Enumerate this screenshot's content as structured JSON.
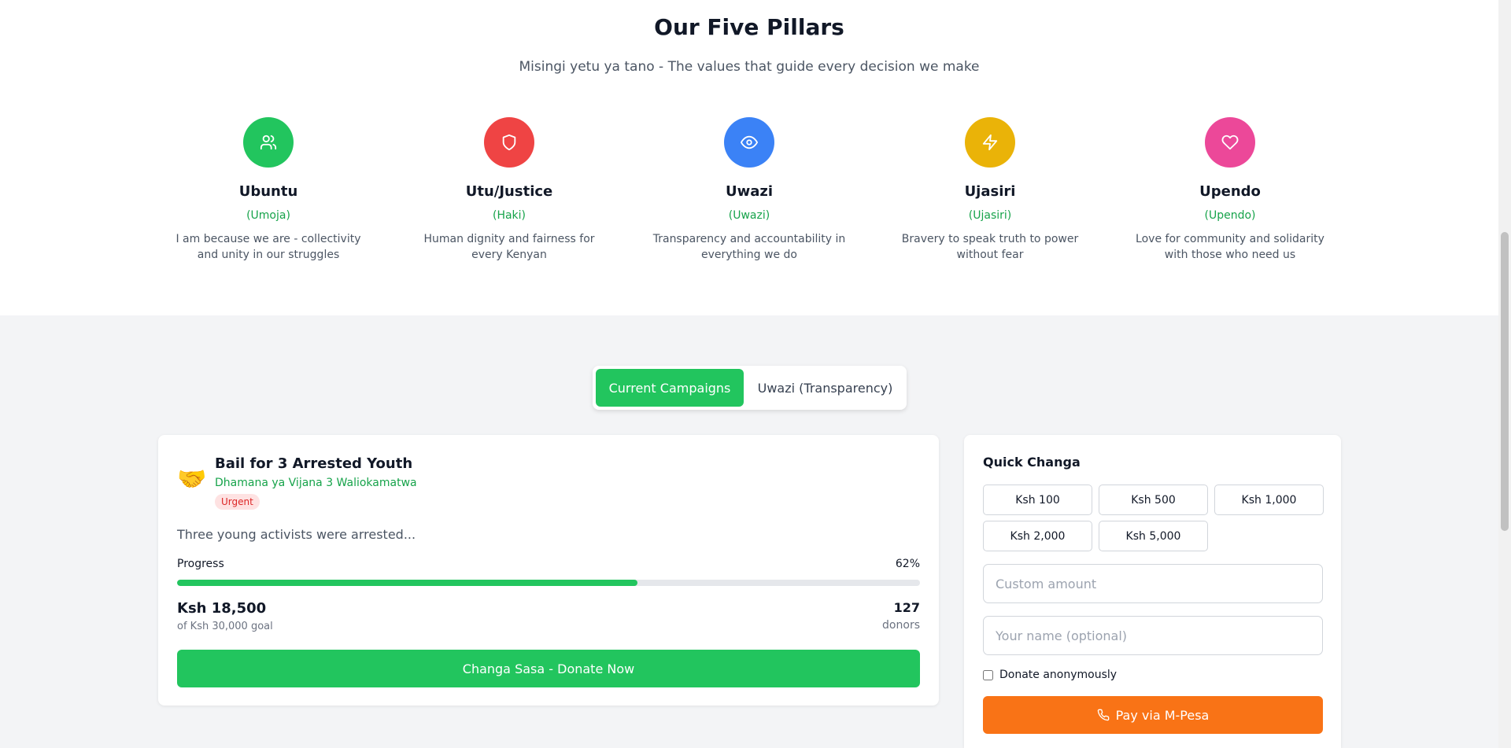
{
  "pillars": {
    "title": "Our Five Pillars",
    "subtitle": "Misingi yetu ya tano - The values that guide every decision we make",
    "items": [
      {
        "name": "Ubuntu",
        "sub": "(Umoja)",
        "desc": "I am because we are - collectivity and unity in our struggles",
        "icon": "users-icon",
        "color": "#22c55e"
      },
      {
        "name": "Utu/Justice",
        "sub": "(Haki)",
        "desc": "Human dignity and fairness for every Kenyan",
        "icon": "shield-icon",
        "color": "#ef4444"
      },
      {
        "name": "Uwazi",
        "sub": "(Uwazi)",
        "desc": "Transparency and accountability in everything we do",
        "icon": "eye-icon",
        "color": "#3b82f6"
      },
      {
        "name": "Ujasiri",
        "sub": "(Ujasiri)",
        "desc": "Bravery to speak truth to power without fear",
        "icon": "lightning-icon",
        "color": "#eab308"
      },
      {
        "name": "Upendo",
        "sub": "(Upendo)",
        "desc": "Love for community and solidarity with those who need us",
        "icon": "heart-icon",
        "color": "#ec4899"
      }
    ]
  },
  "tabs": {
    "current": "Current Campaigns",
    "transparency": "Uwazi (Transparency)"
  },
  "campaign": {
    "emoji": "🤝",
    "title": "Bail for 3 Arrested Youth",
    "subtitle": "Dhamana ya Vijana 3 Waliokamatwa",
    "badge": "Urgent",
    "description": "Three young activists were arrested...",
    "progress_label": "Progress",
    "progress_percent": "62%",
    "progress_value": 62,
    "raised": "Ksh 18,500",
    "goal": "of Ksh 30,000 goal",
    "donors_count": "127",
    "donors_label": "donors",
    "donate_button": "Changa Sasa - Donate Now"
  },
  "quick": {
    "title": "Quick Changa",
    "amounts": [
      "Ksh 100",
      "Ksh 500",
      "Ksh 1,000",
      "Ksh 2,000",
      "Ksh 5,000"
    ],
    "custom_placeholder": "Custom amount",
    "name_placeholder": "Your name (optional)",
    "anonymous_label": "Donate anonymously",
    "pay_button": "Pay via M-Pesa",
    "pay_icon": "phone-icon"
  },
  "colors": {
    "accent_green": "#22c55e",
    "mpesa_orange": "#f97316",
    "urgent_red": "#dc2626"
  }
}
